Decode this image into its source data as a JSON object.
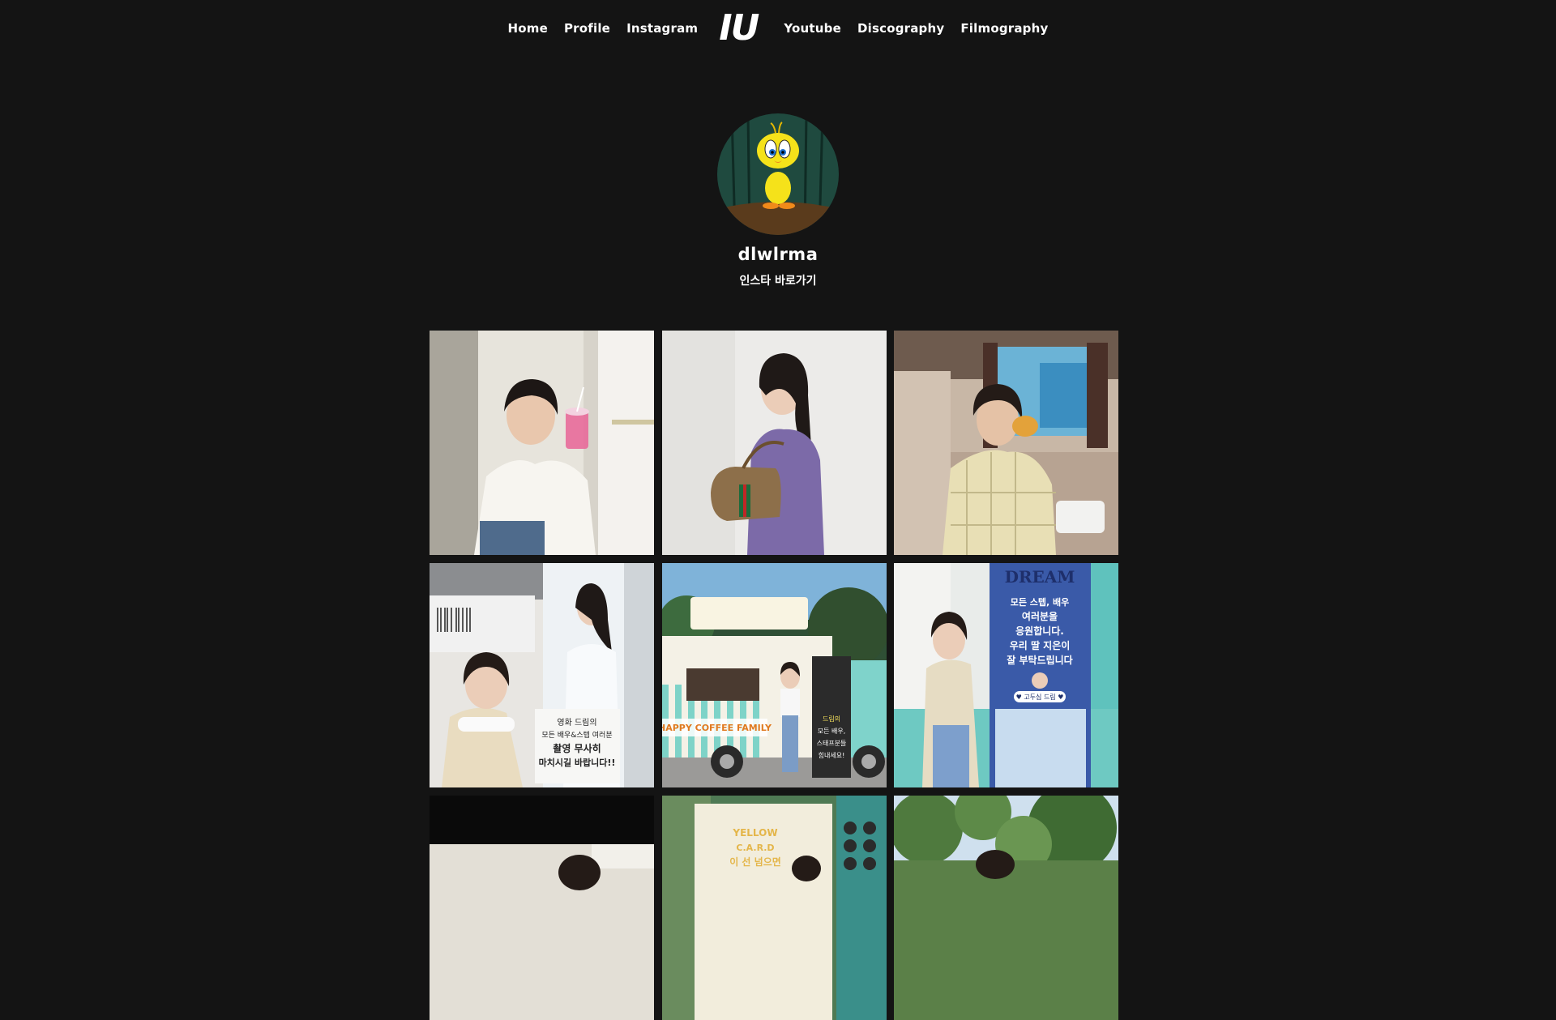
{
  "nav": {
    "left_items": [
      {
        "label": "Home"
      },
      {
        "label": "Profile"
      },
      {
        "label": "Instagram"
      }
    ],
    "logo": "IU",
    "right_items": [
      {
        "label": "Youtube"
      },
      {
        "label": "Discography"
      },
      {
        "label": "Filmography"
      }
    ]
  },
  "profile": {
    "username": "dlwlrma",
    "link_label": "인스타 바로가기",
    "avatar_icon": "tweety-bird-avatar"
  },
  "posts": {
    "tile1": {
      "icon": "photo-cafe-drink"
    },
    "tile2": {
      "icon": "photo-purple-sweater-bag"
    },
    "tile3": {
      "icon": "photo-car-eating"
    },
    "tile4": {
      "icon": "photo-banner-pose",
      "banner_lines": [
        "영화 드림의",
        "모든 배우&스텝 여러분",
        "촬영 무사히",
        "마치시길 바랍니다!!"
      ]
    },
    "tile5": {
      "icon": "photo-coffee-truck",
      "truck_text": "HAPPY COFFEE FAMILY",
      "sign_lines": [
        "드림의",
        "모든 배우,",
        "스태프분들",
        "힘내세요!"
      ]
    },
    "tile6": {
      "icon": "photo-dream-banner",
      "banner_title": "DREAM",
      "banner_lines": [
        "모든 스텝, 배우",
        "여러분을",
        "응원합니다.",
        "우리 딸 지은이",
        "잘 부탁드립니다"
      ],
      "banner_footer": "♥ 고두심 드림 ♥"
    },
    "tile7": {
      "icon": "photo-partial-1"
    },
    "tile8": {
      "icon": "photo-yellow-card",
      "card_lines": [
        "YELLOW",
        "C.A.R.D",
        "이 선 넘으면"
      ]
    },
    "tile9": {
      "icon": "photo-trees"
    }
  },
  "colors": {
    "background": "#141414",
    "text": "#ffffff",
    "avatar_bg": "#1f4a3f",
    "tweety": "#f5e21a"
  }
}
